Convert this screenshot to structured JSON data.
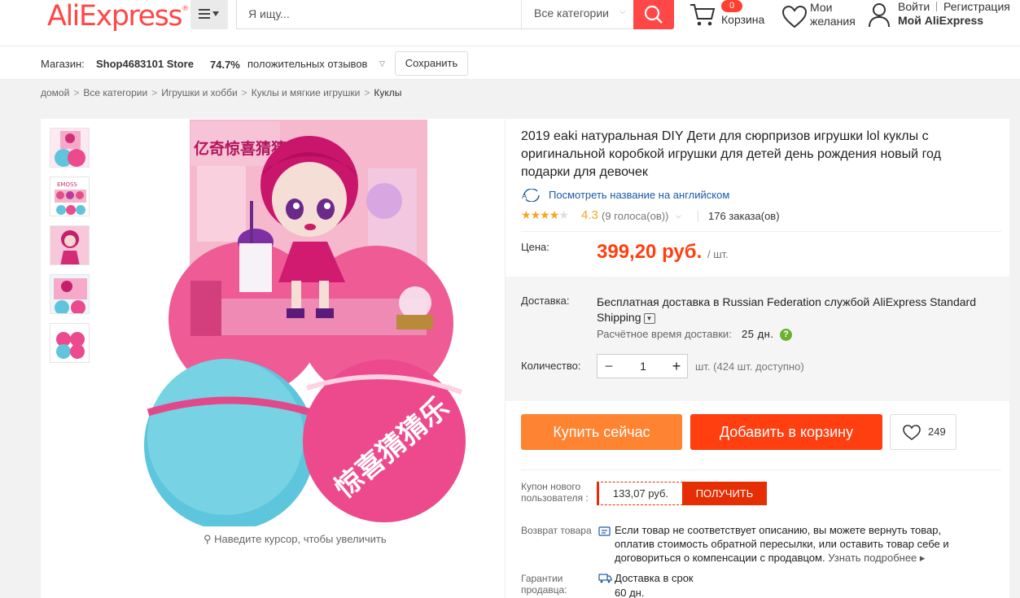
{
  "header": {
    "logo": "AliExpress",
    "logo_mark": "®",
    "search": {
      "placeholder": "Я ищу...",
      "category": "Все категории"
    },
    "cart": {
      "count": "0",
      "label": "Корзина"
    },
    "wishlist": {
      "line1": "Мои",
      "line2": "желания"
    },
    "account": {
      "login": "Войти",
      "register": "Регистрация",
      "my": "Мой AliExpress"
    }
  },
  "store": {
    "label": "Магазин:",
    "name": "Shop4683101 Store",
    "positive_pct": "74.7%",
    "positive_label": "положительных отзывов",
    "save_label": "Сохранить"
  },
  "breadcrumb": [
    "домой",
    "Все категории",
    "Игрушки и хобби",
    "Куклы и мягкие игрушки",
    "Куклы"
  ],
  "gallery": {
    "zoom_hint": "Наведите курсор, чтобы увеличить",
    "main_image_text": "亿奇惊喜猜猜乐",
    "ball_text": "惊喜猜猜乐",
    "thumb_text": "EMOSS"
  },
  "product": {
    "title": "2019 eaki натуральная DIY Дети для сюрпризов игрушки lol куклы с оригинальной коробкой игрушки для детей день рождения новый год подарки для девочек",
    "translate_link": "Посмотреть название на английском",
    "rating": "4.3",
    "rating_value": 4.3,
    "votes": "(9 голоса(ов))",
    "orders": "176 заказа(ов)",
    "price_label": "Цена:",
    "price": "399,20 руб.",
    "price_unit": "/ шт.",
    "shipping_label": "Доставка:",
    "shipping_prefix": "Бесплатная доставка в",
    "shipping_rest": " Russian Federation службой AliExpress Standard Shipping",
    "delivery_time_label": "Расчётное время доставки:",
    "delivery_time": "25 дн.",
    "help_mark": "?",
    "quantity_label": "Количество:",
    "quantity": "1",
    "quantity_available": "шт. (424 шт. доступно)",
    "buy_now": "Купить сейчас",
    "add_to_cart": "Добавить в корзину",
    "wish_count": "249",
    "coupon_label": "Купон нового пользователя :",
    "coupon_value": "133,07 руб.",
    "coupon_button": "ПОЛУЧИТЬ",
    "return_label": "Возврат товара",
    "return_text": "Если товар не соответствует описанию, вы можете вернуть товар, оплатив стоимость обратной пересылки, или оставить товар себе и договориться о компенсации с продавцом.",
    "return_more": "Узнать подробнее ▸",
    "guarantee_label": "Гарантии продавца:",
    "guarantee_text_1": "Доставка в срок",
    "guarantee_text_2": "60 дн."
  },
  "colors": {
    "brand": "#ff4747",
    "buy": "#ff8432",
    "cart": "#ff3f0f",
    "price": "#ff3f0f",
    "rating": "#f5a623",
    "link": "#1a5aa6"
  }
}
